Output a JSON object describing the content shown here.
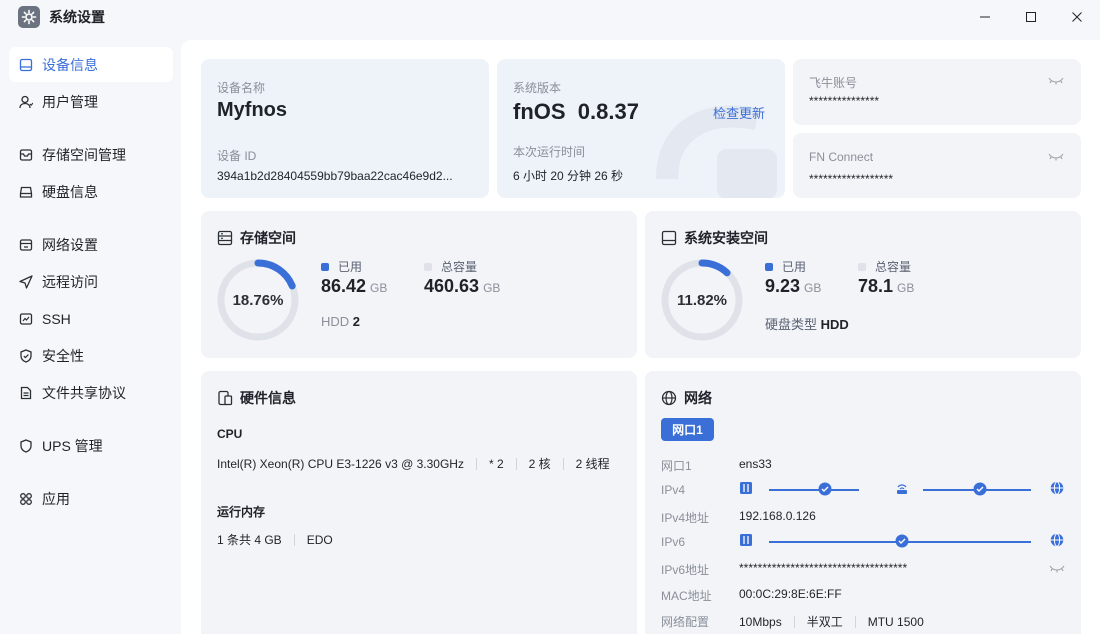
{
  "window": {
    "title": "系统设置"
  },
  "sidebar": {
    "items": [
      {
        "label": "设备信息",
        "icon": "device-icon",
        "active": true
      },
      {
        "label": "用户管理",
        "icon": "user-icon"
      },
      {
        "label": "存储空间管理",
        "icon": "storage-icon"
      },
      {
        "label": "硬盘信息",
        "icon": "disk-icon"
      },
      {
        "label": "网络设置",
        "icon": "network-icon"
      },
      {
        "label": "远程访问",
        "icon": "remote-icon"
      },
      {
        "label": "SSH",
        "icon": "terminal-icon"
      },
      {
        "label": "安全性",
        "icon": "shield-icon"
      },
      {
        "label": "文件共享协议",
        "icon": "file-icon"
      },
      {
        "label": "UPS 管理",
        "icon": "ups-icon"
      },
      {
        "label": "应用",
        "icon": "apps-icon"
      }
    ]
  },
  "device": {
    "name_label": "设备名称",
    "name": "Myfnos",
    "id_label": "设备 ID",
    "id": "394a1b2d28404559bb79baa22cac46e9d2..."
  },
  "system": {
    "version_label": "系统版本",
    "version": "fnOS  0.8.37",
    "check_update": "检查更新",
    "uptime_label": "本次运行时间",
    "uptime": "6 小时 20 分钟 26 秒"
  },
  "accounts": {
    "feiniu_label": "飞牛账号",
    "feiniu_value": "***************",
    "fnconnect_label": "FN Connect",
    "fnconnect_value": "******************"
  },
  "storage": {
    "title": "存储空间",
    "percent": "18.76%",
    "percent_value": 18.76,
    "used_label": "已用",
    "used": "86.42",
    "used_unit": "GB",
    "total_label": "总容量",
    "total": "460.63",
    "total_unit": "GB",
    "hdd_label": "HDD",
    "hdd_count": "2"
  },
  "sysinstall": {
    "title": "系统安装空间",
    "percent": "11.82%",
    "percent_value": 11.82,
    "used_label": "已用",
    "used": "9.23",
    "used_unit": "GB",
    "total_label": "总容量",
    "total": "78.1",
    "total_unit": "GB",
    "disk_type_label": "硬盘类型",
    "disk_type": "HDD"
  },
  "hardware": {
    "title": "硬件信息",
    "cpu_label": "CPU",
    "cpu_model": "Intel(R) Xeon(R) CPU E3-1226 v3 @ 3.30GHz",
    "cpu_count": "* 2",
    "cores": "2 核",
    "threads": "2 线程",
    "mem_label": "运行内存",
    "mem_size": "1 条共 4 GB",
    "mem_type": "EDO"
  },
  "network": {
    "title": "网络",
    "port_tab": "网口1",
    "rows": {
      "port_label": "网口1",
      "port_value": "ens33",
      "ipv4_label": "IPv4",
      "ipv4_addr_label": "IPv4地址",
      "ipv4_addr": "192.168.0.126",
      "ipv6_label": "IPv6",
      "ipv6_addr_label": "IPv6地址",
      "ipv6_addr": "************************************",
      "mac_label": "MAC地址",
      "mac": "00:0C:29:8E:6E:FF",
      "config_label": "网络配置",
      "speed": "10Mbps",
      "duplex": "半双工",
      "mtu": "MTU 1500"
    }
  },
  "colors": {
    "accent": "#3b6fd8",
    "ring_track": "#dfe2e8",
    "card_bg": "#f2f4f8"
  }
}
